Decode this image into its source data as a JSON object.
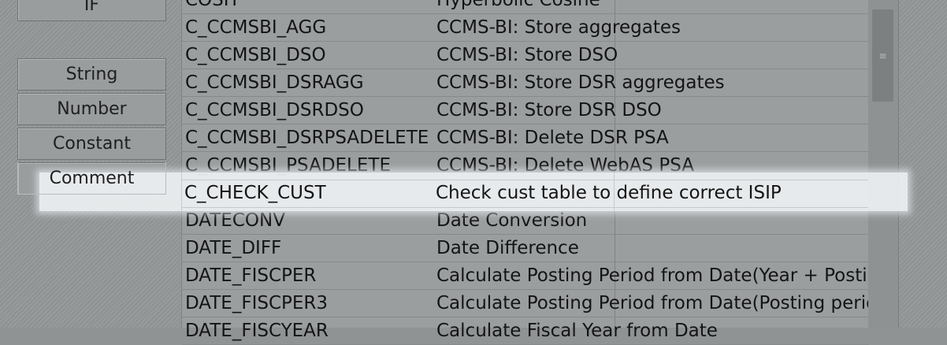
{
  "buttons": {
    "if_label": "IF",
    "string_label": "String",
    "number_label": "Number",
    "constant_label": "Constant",
    "comment_label": "Comment"
  },
  "functions": [
    {
      "name": "COSH",
      "description": "Hyperbolic Cosine"
    },
    {
      "name": "C_CCMSBI_AGG",
      "description": "CCMS-BI: Store aggregates"
    },
    {
      "name": "C_CCMSBI_DSO",
      "description": "CCMS-BI: Store DSO"
    },
    {
      "name": "C_CCMSBI_DSRAGG",
      "description": "CCMS-BI: Store DSR aggregates"
    },
    {
      "name": "C_CCMSBI_DSRDSO",
      "description": "CCMS-BI: Store DSR DSO"
    },
    {
      "name": "C_CCMSBI_DSRPSADELETE",
      "description": "CCMS-BI: Delete DSR PSA"
    },
    {
      "name": "C_CCMSBI_PSADELETE",
      "description": "CCMS-BI: Delete WebAS PSA"
    },
    {
      "name": "C_CHECK_CUST",
      "description": "Check cust table to define correct ISIP"
    },
    {
      "name": "DATECONV",
      "description": "Date Conversion"
    },
    {
      "name": "DATE_DIFF",
      "description": "Date Difference"
    },
    {
      "name": "DATE_FISCPER",
      "description": "Calculate Posting Period from Date(Year + Posting P"
    },
    {
      "name": "DATE_FISCPER3",
      "description": "Calculate Posting Period from Date(Posting period)"
    },
    {
      "name": "DATE_FISCYEAR",
      "description": "Calculate Fiscal Year from Date"
    }
  ],
  "scrollbar": {
    "grip": "≡"
  }
}
